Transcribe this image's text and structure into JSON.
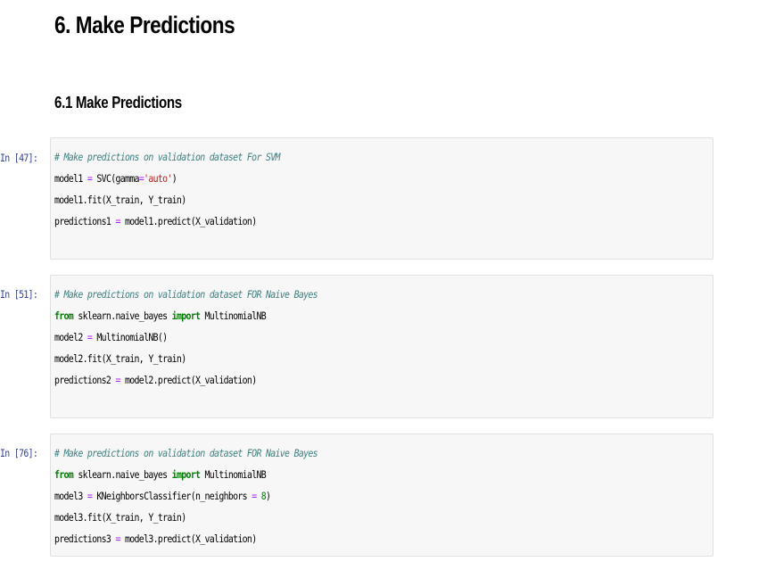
{
  "heading": "6. Make Predictions",
  "subheading": "6.1 Make Predictions",
  "cells": [
    {
      "prompt": "In [47]:",
      "lines": [
        [
          {
            "t": "comment",
            "v": "# Make predictions on validation dataset For SVM"
          }
        ],
        [
          {
            "t": "plain",
            "v": "model1 "
          },
          {
            "t": "op",
            "v": "="
          },
          {
            "t": "plain",
            "v": " SVC(gamma"
          },
          {
            "t": "op",
            "v": "="
          },
          {
            "t": "string",
            "v": "'auto'"
          },
          {
            "t": "plain",
            "v": ")"
          }
        ],
        [
          {
            "t": "plain",
            "v": "model1.fit(X_train, Y_train)"
          }
        ],
        [
          {
            "t": "plain",
            "v": "predictions1 "
          },
          {
            "t": "op",
            "v": "="
          },
          {
            "t": "plain",
            "v": " model1.predict(X_validation)"
          }
        ]
      ]
    },
    {
      "prompt": "In [51]:",
      "lines": [
        [
          {
            "t": "comment",
            "v": "# Make predictions on validation dataset FOR Naive Bayes"
          }
        ],
        [
          {
            "t": "keyword",
            "v": "from"
          },
          {
            "t": "plain",
            "v": " sklearn.naive_bayes "
          },
          {
            "t": "keyword",
            "v": "import"
          },
          {
            "t": "plain",
            "v": " MultinomialNB"
          }
        ],
        [
          {
            "t": "plain",
            "v": "model2 "
          },
          {
            "t": "op",
            "v": "="
          },
          {
            "t": "plain",
            "v": " MultinomialNB()"
          }
        ],
        [
          {
            "t": "plain",
            "v": "model2.fit(X_train, Y_train)"
          }
        ],
        [
          {
            "t": "plain",
            "v": "predictions2 "
          },
          {
            "t": "op",
            "v": "="
          },
          {
            "t": "plain",
            "v": " model2.predict(X_validation)"
          }
        ]
      ]
    },
    {
      "prompt": "In [76]:",
      "lines": [
        [
          {
            "t": "comment",
            "v": "# Make predictions on validation dataset FOR Naive Bayes"
          }
        ],
        [
          {
            "t": "keyword",
            "v": "from"
          },
          {
            "t": "plain",
            "v": " sklearn.naive_bayes "
          },
          {
            "t": "keyword",
            "v": "import"
          },
          {
            "t": "plain",
            "v": " MultinomialNB"
          }
        ],
        [
          {
            "t": "plain",
            "v": "model3 "
          },
          {
            "t": "op",
            "v": "="
          },
          {
            "t": "plain",
            "v": " KNeighborsClassifier(n_neighbors "
          },
          {
            "t": "op",
            "v": "="
          },
          {
            "t": "plain",
            "v": " "
          },
          {
            "t": "number",
            "v": "8"
          },
          {
            "t": "plain",
            "v": ")"
          }
        ],
        [
          {
            "t": "plain",
            "v": "model3.fit(X_train, Y_train)"
          }
        ],
        [
          {
            "t": "plain",
            "v": "predictions3 "
          },
          {
            "t": "op",
            "v": "="
          },
          {
            "t": "plain",
            "v": " model3.predict(X_validation)"
          }
        ]
      ]
    }
  ]
}
